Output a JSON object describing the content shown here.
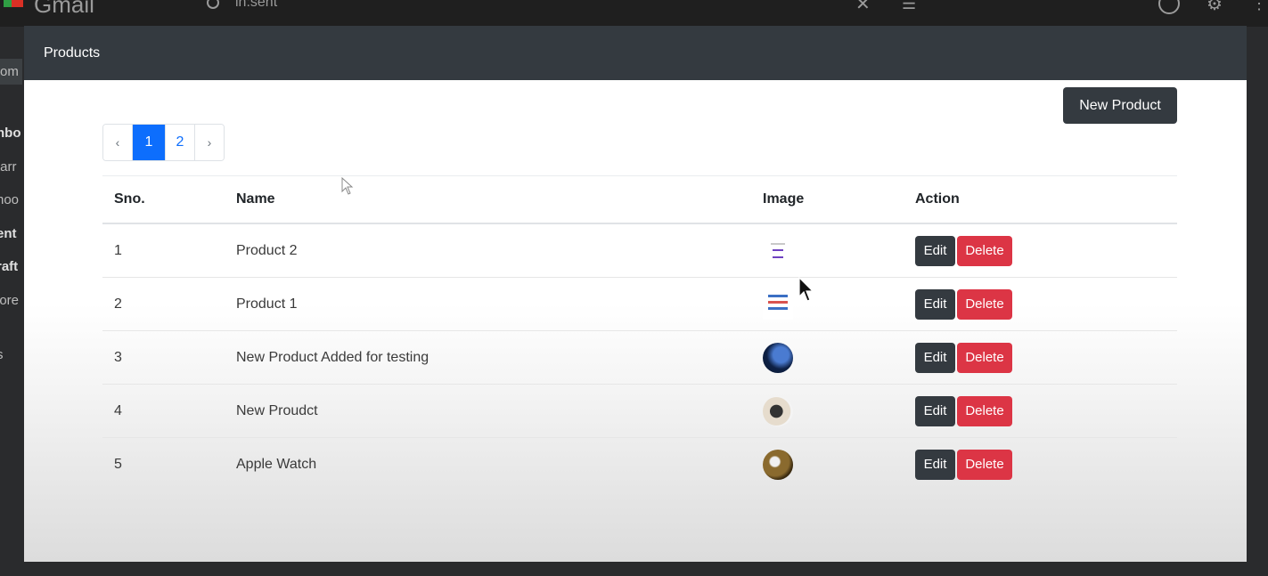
{
  "background_app": {
    "name": "Gmail",
    "search_text": "in:sent",
    "sidebar_items": [
      "om",
      "nbo",
      "tarr",
      "noo",
      "ent",
      "raft",
      "lore",
      "s"
    ]
  },
  "modal": {
    "title": "Products",
    "new_button_label": "New Product"
  },
  "pagination": {
    "prev": "‹",
    "pages": [
      "1",
      "2"
    ],
    "active_page": "1",
    "next": "›"
  },
  "table": {
    "headers": [
      "Sno.",
      "Name",
      "Image",
      "Action"
    ],
    "rows": [
      {
        "sno": "1",
        "name": "Product 2",
        "image_icon": "document-thumbnail"
      },
      {
        "sno": "2",
        "name": "Product 1",
        "image_icon": "text-image-thumbnail"
      },
      {
        "sno": "3",
        "name": "New Product Added for testing",
        "image_icon": "blue-circle-thumbnail"
      },
      {
        "sno": "4",
        "name": "New Proudct",
        "image_icon": "watch-thumbnail"
      },
      {
        "sno": "5",
        "name": "Apple Watch",
        "image_icon": "gold-circle-thumbnail"
      }
    ],
    "edit_label": "Edit",
    "delete_label": "Delete"
  },
  "colors": {
    "header_bg": "#343a40",
    "primary": "#0d6efd",
    "danger": "#dc3545"
  }
}
